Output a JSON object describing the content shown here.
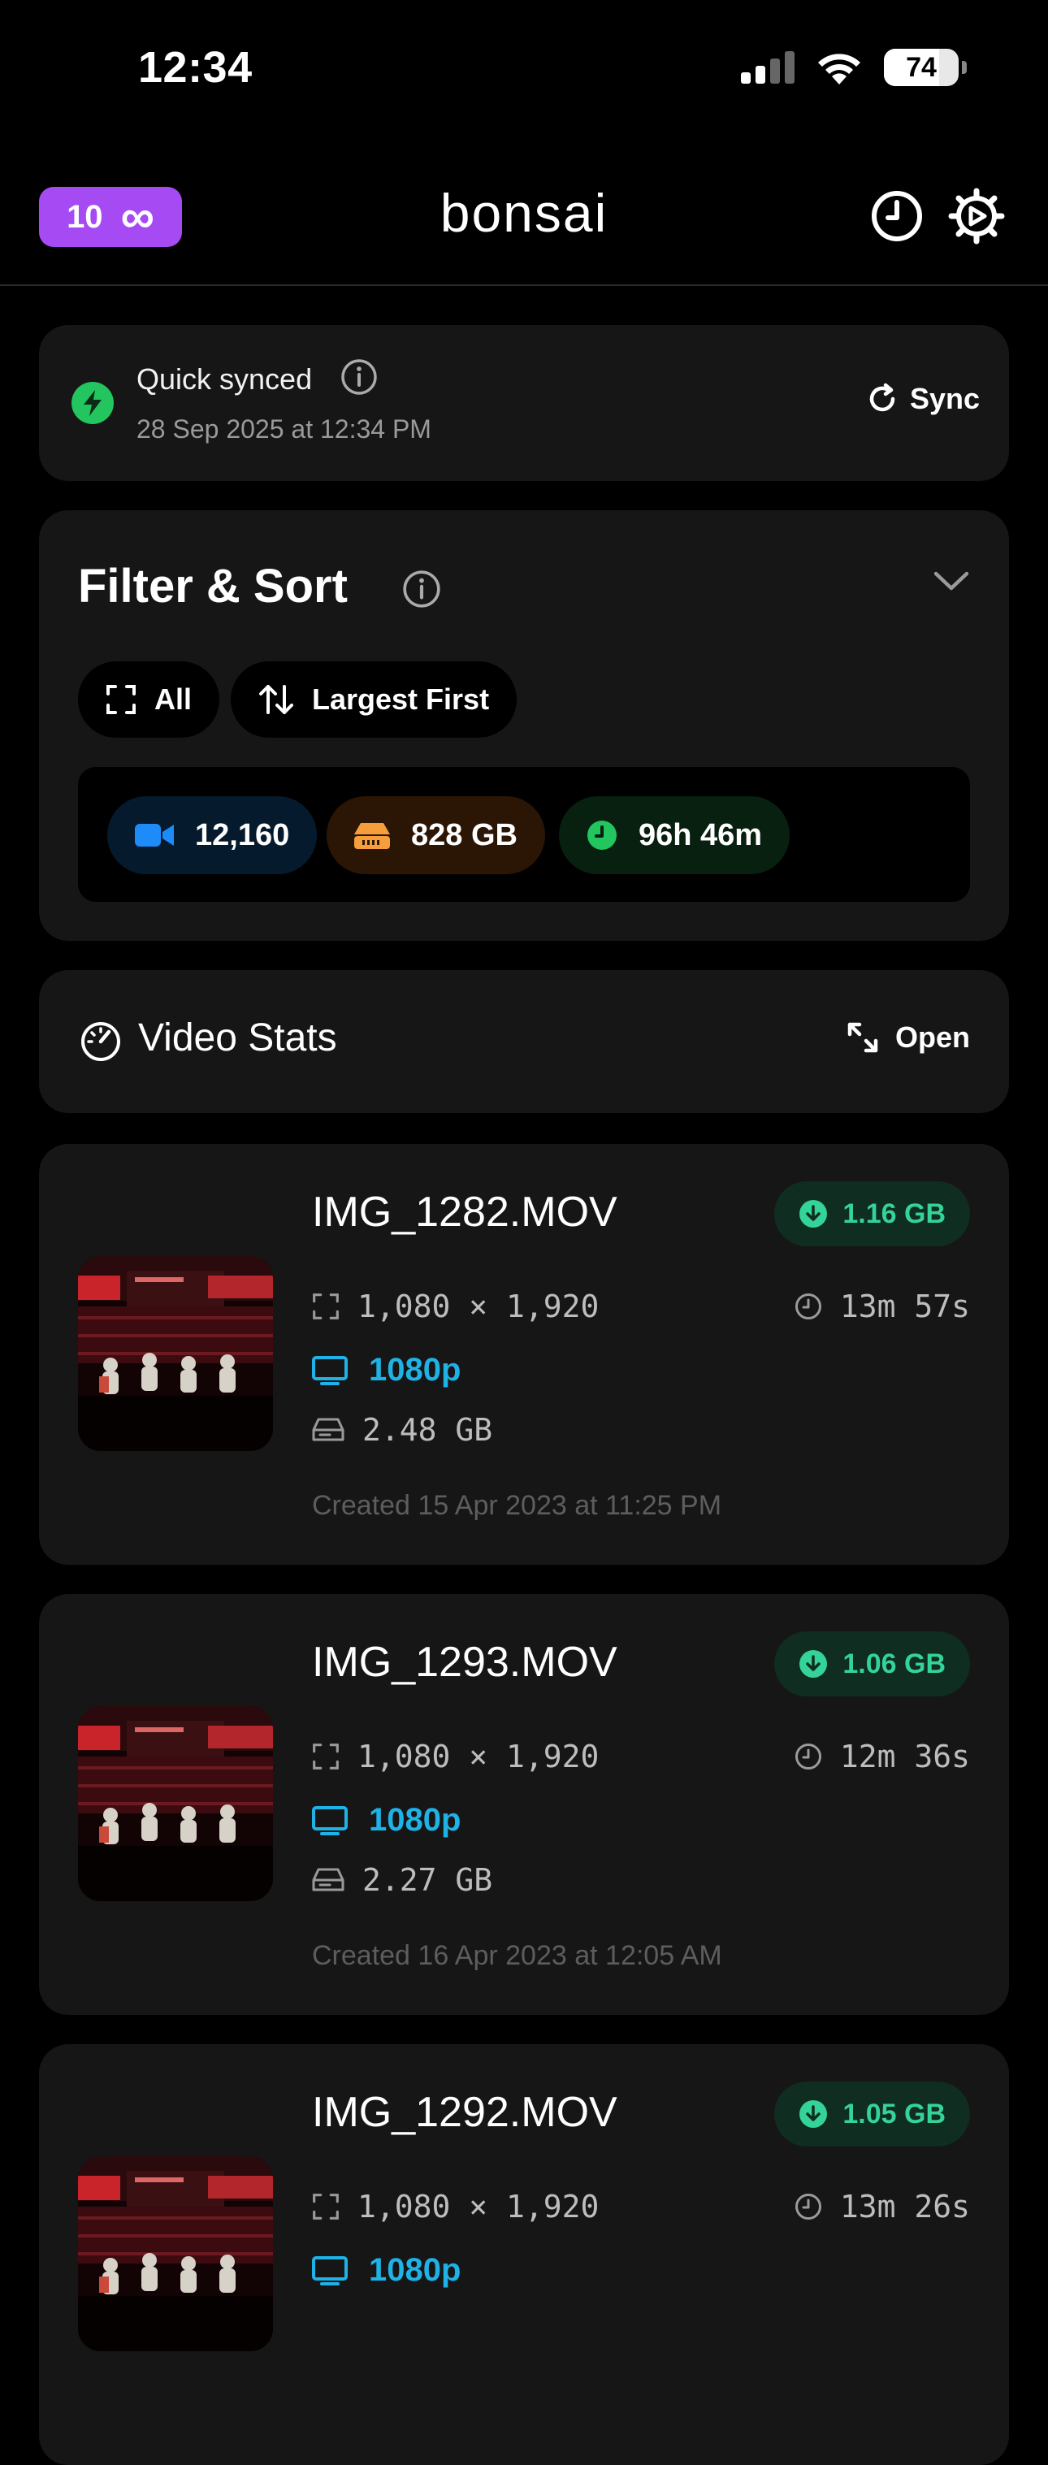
{
  "status_bar": {
    "time": "12:34",
    "battery": "74",
    "battery_level": 0.74
  },
  "header": {
    "credits_count": "10",
    "credits_symbol": "∞",
    "logo": "bonsai"
  },
  "sync": {
    "title": "Quick synced",
    "date": "28 Sep 2025 at 12:34 PM",
    "button_label": "Sync"
  },
  "filter": {
    "title": "Filter & Sort",
    "scope_chip": "All",
    "sort_chip": "Largest First",
    "stats": {
      "count": "12,160",
      "size": "828 GB",
      "duration": "96h 46m"
    }
  },
  "video_stats": {
    "label": "Video Stats",
    "open_label": "Open"
  },
  "videos": [
    {
      "name": "IMG_1282.MOV",
      "savings": "1.16 GB",
      "dimensions": "1,080 × 1,920",
      "duration": "13m 57s",
      "resolution": "1080p",
      "size": "2.48 GB",
      "created": "Created 15 Apr 2023 at 11:25 PM"
    },
    {
      "name": "IMG_1293.MOV",
      "savings": "1.06 GB",
      "dimensions": "1,080 × 1,920",
      "duration": "12m 36s",
      "resolution": "1080p",
      "size": "2.27 GB",
      "created": "Created 16 Apr 2023 at 12:05 AM"
    },
    {
      "name": "IMG_1292.MOV",
      "savings": "1.05 GB",
      "dimensions": "1,080 × 1,920",
      "duration": "13m 26s",
      "resolution": "1080p"
    }
  ],
  "colors": {
    "accent_purple": "#a64bf4",
    "sync_green": "#22c55e",
    "savings_green": "#34d399",
    "resolution_blue": "#1fb2e6",
    "count_blue": "#1d8cf8",
    "size_orange": "#f59e3b"
  },
  "icons": {
    "header_history": "clock-icon",
    "header_settings": "gear-icon",
    "sync_status": "bolt-icon",
    "stats": "speedometer-icon"
  }
}
